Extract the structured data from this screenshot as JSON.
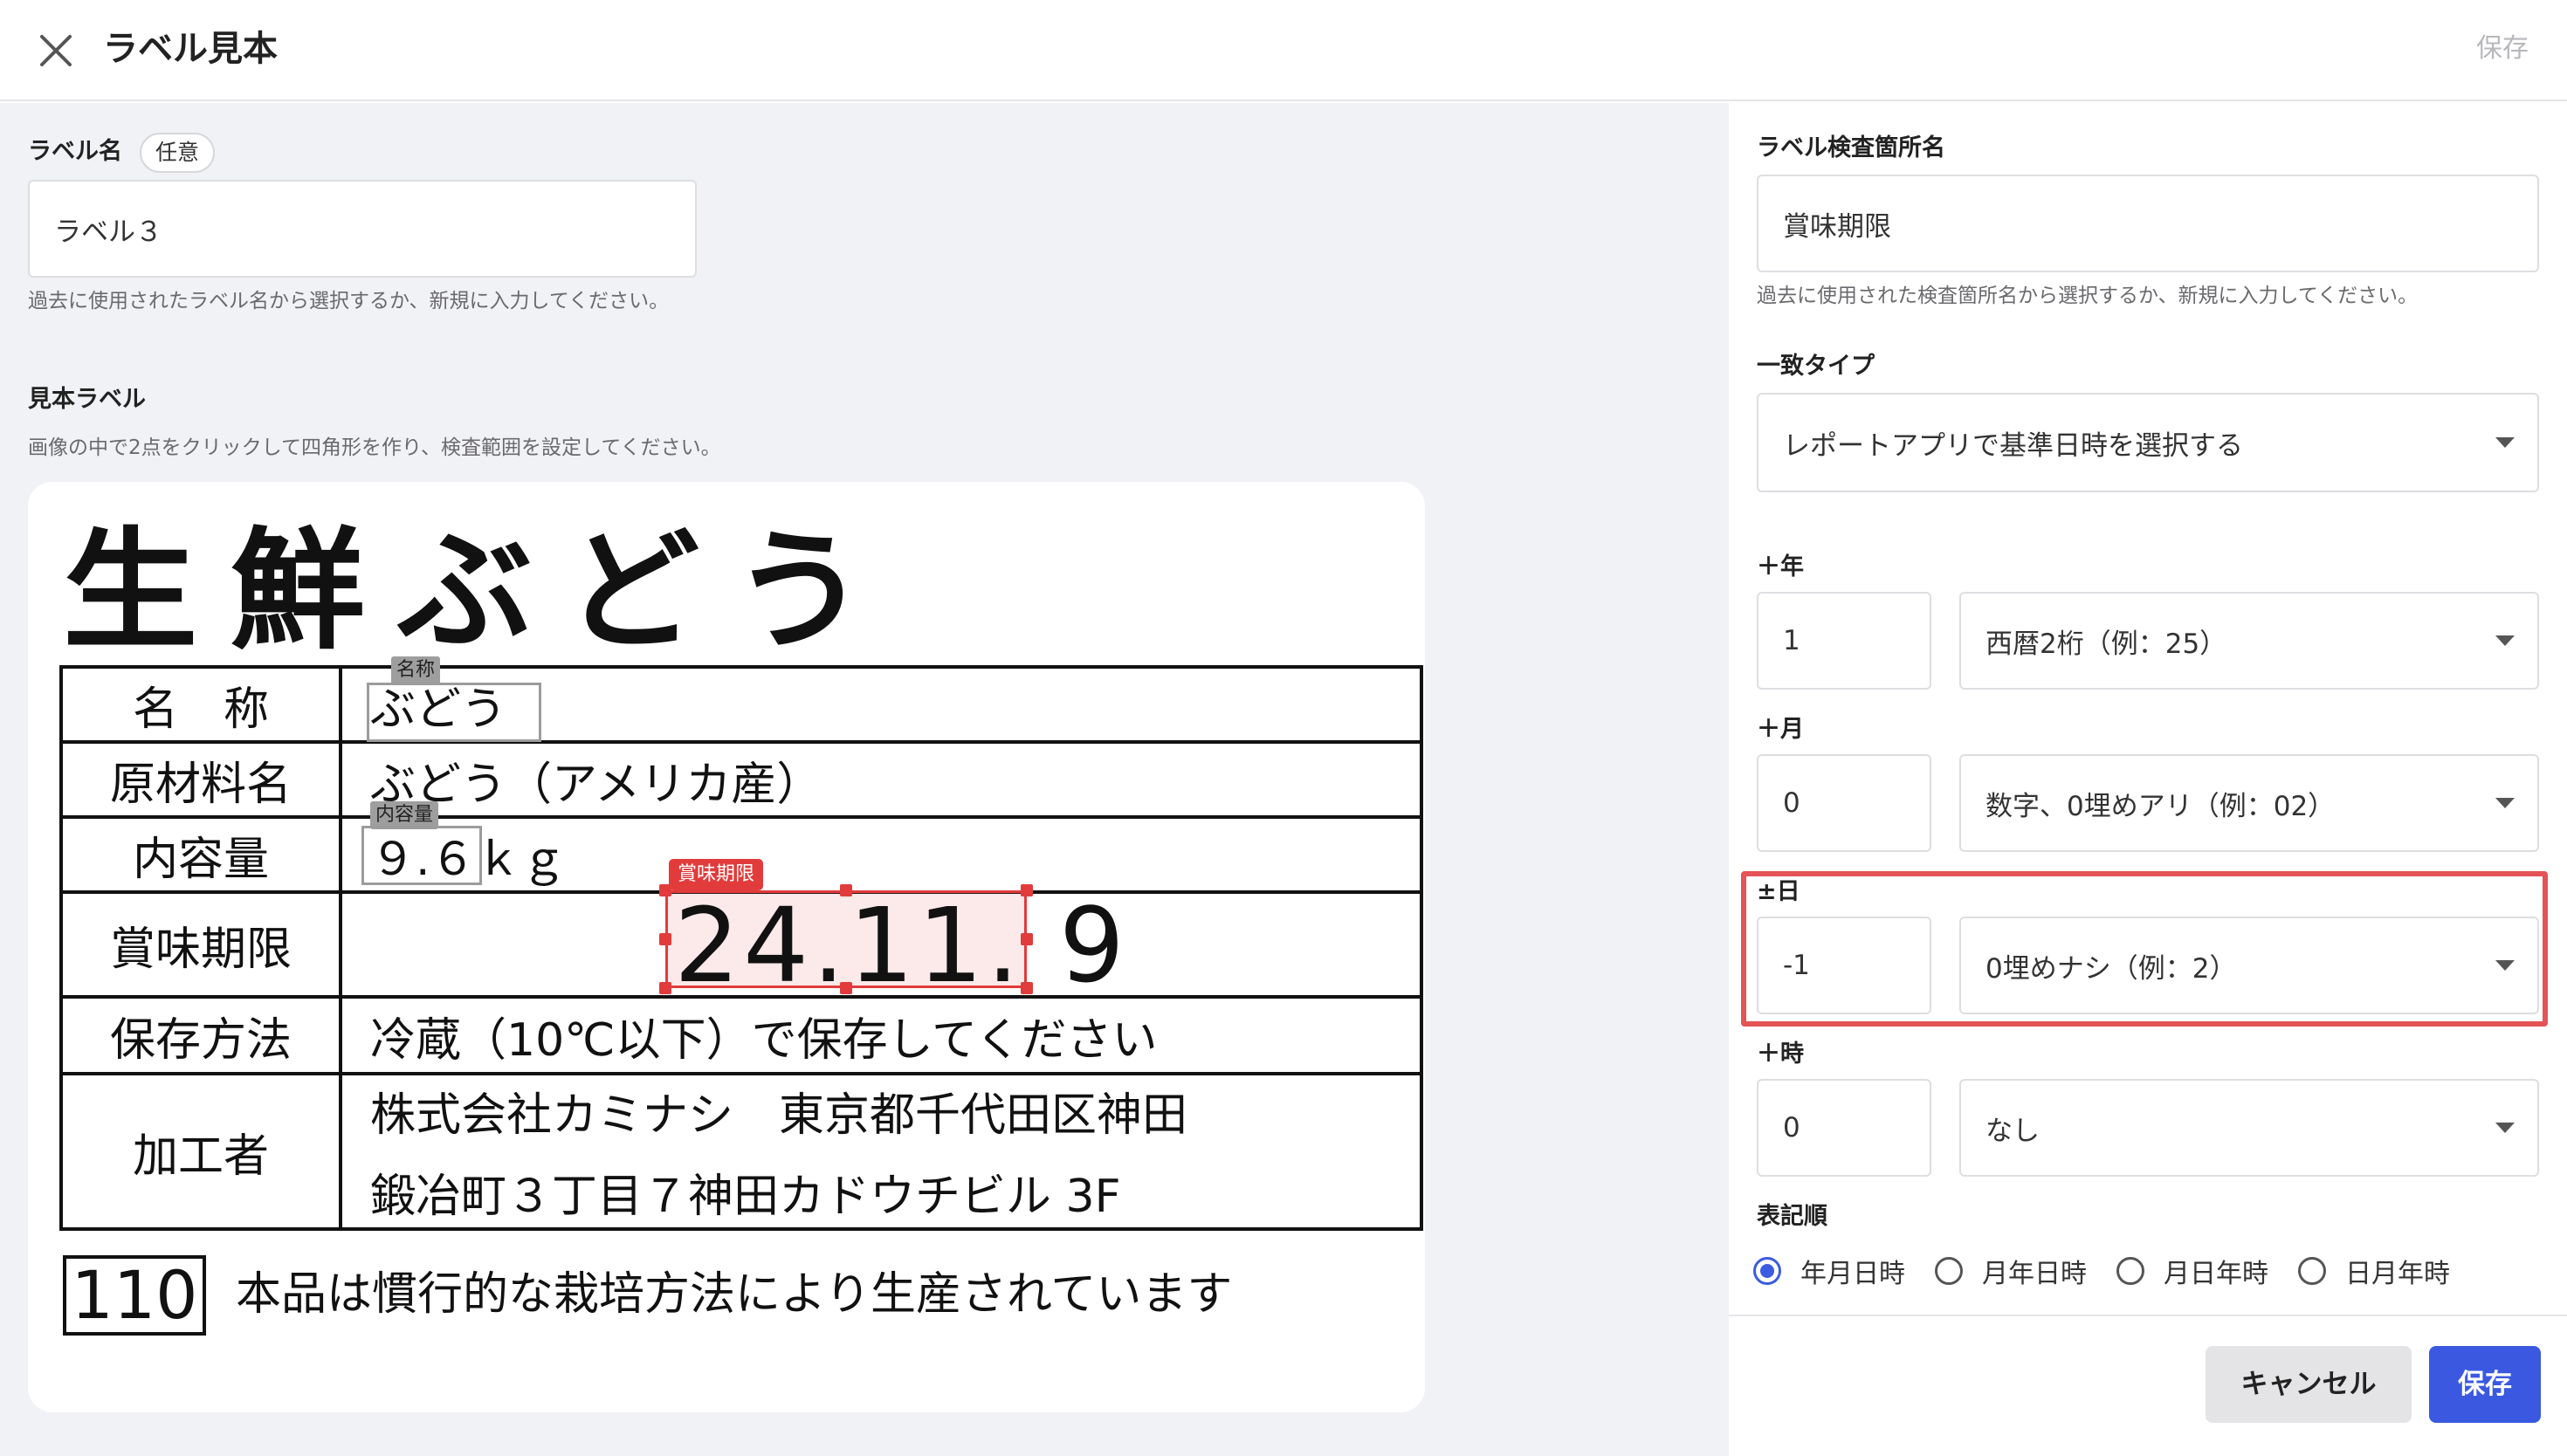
{
  "header": {
    "title": "ラベル見本",
    "save_label": "保存",
    "close_icon": "close-icon"
  },
  "left": {
    "label_name": {
      "label": "ラベル名",
      "badge": "任意",
      "value": "ラベル３",
      "helper": "過去に使用されたラベル名から選択するか、新規に入力してください。"
    },
    "sample": {
      "label": "見本ラベル",
      "helper": "画像の中で2点をクリックして四角形を作り、検査範囲を設定してください。"
    }
  },
  "label_image": {
    "title": "生鮮ぶどう",
    "rows": [
      {
        "key": "名　称",
        "value": "ぶどう"
      },
      {
        "key": "原材料名",
        "value": "ぶどう（アメリカ産）"
      },
      {
        "key": "内容量",
        "value": "９.６ｋｇ"
      },
      {
        "key": "賞味期限",
        "value": "24.11. 9"
      },
      {
        "key": "保存方法",
        "value": "冷蔵（10℃以下）で保存してください"
      },
      {
        "key": "加工者",
        "value_line1": "株式会社カミナシ　東京都千代田区神田",
        "value_line2": "鍛冶町３丁目７神田カドウチビル 3F"
      }
    ],
    "code": "110",
    "note": "本品は慣行的な栽培方法により生産されています",
    "regions": [
      {
        "name": "名称",
        "kind": "grey"
      },
      {
        "name": "内容量",
        "kind": "grey"
      },
      {
        "name": "賞味期限",
        "kind": "red",
        "selected": true
      }
    ]
  },
  "right": {
    "inspection_name": {
      "label": "ラベル検査箇所名",
      "value": "賞味期限",
      "helper": "過去に使用された検査箇所名から選択するか、新規に入力してください。"
    },
    "match_type": {
      "label": "一致タイプ",
      "value": "レポートアプリで基準日時を選択する"
    },
    "offsets": [
      {
        "label": "＋年",
        "value": "1",
        "format": "西暦2桁（例：25）"
      },
      {
        "label": "＋月",
        "value": "0",
        "format": "数字、0埋めアリ（例：02）"
      },
      {
        "label": "±日",
        "value": "-1",
        "format": "0埋めナシ（例：2）"
      },
      {
        "label": "＋時",
        "value": "0",
        "format": "なし"
      }
    ],
    "order": {
      "label": "表記順",
      "options": [
        "年月日時",
        "月年日時",
        "月日年時",
        "日月年時"
      ],
      "selected": "年月日時"
    }
  },
  "footer": {
    "cancel_label": "キャンセル",
    "save_label": "保存"
  },
  "colors": {
    "primary": "#3a59e0",
    "highlight": "#e45356",
    "region_red": "#e23b3b",
    "region_grey": "#9e9e9e"
  }
}
